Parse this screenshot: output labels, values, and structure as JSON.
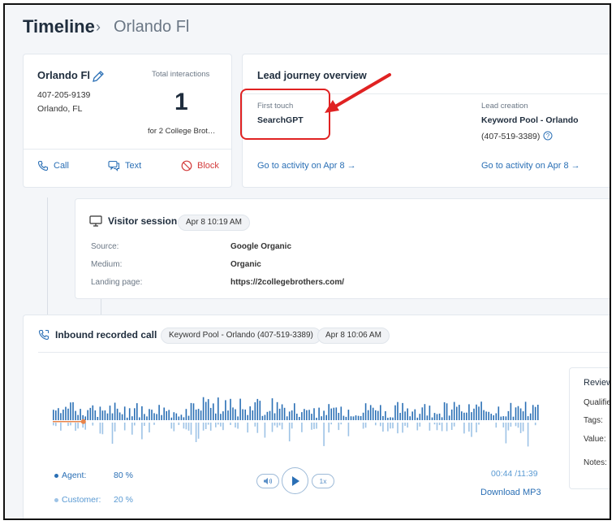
{
  "header": {
    "title": "Timeline",
    "separator": "›",
    "breadcrumb": "Orlando Fl"
  },
  "contact": {
    "name": "Orlando Fl",
    "phone": "407-205-9139",
    "location": "Orlando, FL",
    "total_label": "Total interactions",
    "total_value": "1",
    "total_for": "for 2 College Brot…",
    "actions": {
      "call": "Call",
      "text": "Text",
      "block": "Block"
    }
  },
  "journey": {
    "title": "Lead journey overview",
    "first_touch": {
      "label": "First touch",
      "value": "SearchGPT",
      "link": "Go to activity on Apr 8 →"
    },
    "lead_creation": {
      "label": "Lead creation",
      "value": "Keyword Pool - Orlando",
      "phone": "(407-519-3389)",
      "link": "Go to activity on Apr 8 →"
    }
  },
  "visitor": {
    "title": "Visitor session",
    "date": "Apr 8  10:19 AM",
    "rows": [
      {
        "label": "Source:",
        "value": "Google Organic"
      },
      {
        "label": "Medium:",
        "value": "Organic"
      },
      {
        "label": "Landing page:",
        "value": "https://2collegebrothers.com/"
      }
    ]
  },
  "call": {
    "title": "Inbound recorded call",
    "source_pill": "Keyword Pool - Orlando (407-519-3389)",
    "date_pill": "Apr 8  10:06 AM",
    "agent_label": "Agent:",
    "agent_pct": "80 %",
    "customer_label": "Customer:",
    "customer_pct": "20 %",
    "speed": "1x",
    "time": "00:44 /11:39",
    "download": "Download MP3",
    "review": {
      "title": "Review",
      "qualified": "Qualified",
      "tags": "Tags:",
      "value": "Value:",
      "notes": "Notes:"
    },
    "progress": 0.063
  },
  "colors": {
    "accent": "#2a6fb5",
    "agent_bar": "#2a6fb5",
    "customer_bar": "#9dc3e6",
    "annotation": "#e02222",
    "progress": "#e8844a"
  }
}
